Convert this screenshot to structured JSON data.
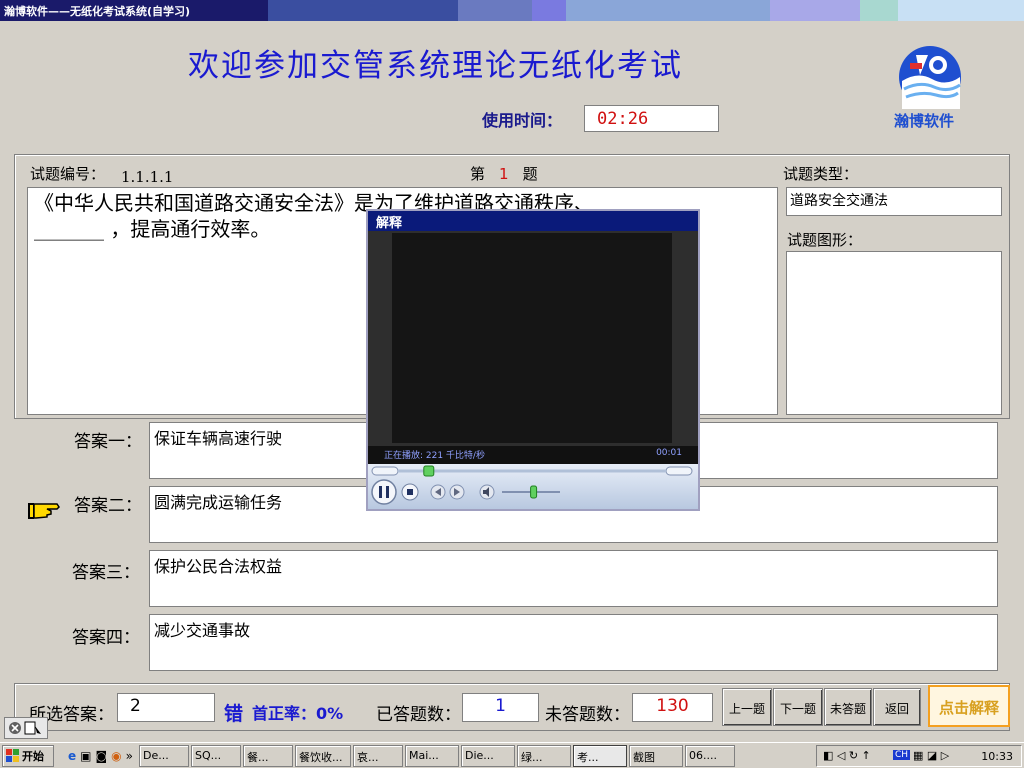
{
  "window": {
    "title": "瀚博软件——无纸化考试系统(自学习)"
  },
  "header": {
    "heading": "欢迎参加交管系统理论无纸化考试",
    "time_label": "使用时间：",
    "time_value": "02:26",
    "logo_text": "瀚博软件"
  },
  "question": {
    "id_label": "试题编号：",
    "id_value": "1.1.1.1",
    "no_prefix": "第",
    "no_value": "1",
    "no_suffix": "题",
    "type_label": "试题类型：",
    "type_value": "道路安全交通法",
    "figure_label": "试题图形：",
    "text_line1": "《中华人民共和国道路交通安全法》是为了维护道路交通秩序、",
    "text_line2": "_______ ，提高通行效率。"
  },
  "answers": [
    {
      "label": "答案一：",
      "text": "保证车辆高速行驶"
    },
    {
      "label": "答案二：",
      "text": "圆满完成运输任务"
    },
    {
      "label": "答案三：",
      "text": "保护公民合法权益"
    },
    {
      "label": "答案四：",
      "text": "减少交通事故"
    }
  ],
  "bottom": {
    "selected_label": "所选答案：",
    "selected_value": "2",
    "wrong_label": "错",
    "accuracy_label": "首正率：0%",
    "answered_label": "已答题数：",
    "answered_value": "1",
    "unanswered_label": "未答题数：",
    "unanswered_value": "130",
    "prev": "上一题",
    "next": "下一题",
    "unanswered_btn": "未答题",
    "back": "返回",
    "explain": "点击解释"
  },
  "player": {
    "title": "解释",
    "status_left": "正在播放: 221 千比特/秒",
    "status_right": "00:01",
    "seek_fraction": 0.1,
    "volume_fraction": 0.55
  },
  "taskbar": {
    "start": "开始",
    "items": [
      "De...",
      "SQ...",
      "餐...",
      "餐饮收...",
      "哀...",
      "Mai...",
      "Die...",
      "绿...",
      "考...",
      "截图",
      "06...."
    ],
    "tray_lang": "CH",
    "clock": "10:33"
  },
  "colors": {
    "heading": "#1a1ad0",
    "accent_red": "#d01010",
    "title_bar": "#0a1a7a",
    "explain_border": "#f4a020"
  }
}
